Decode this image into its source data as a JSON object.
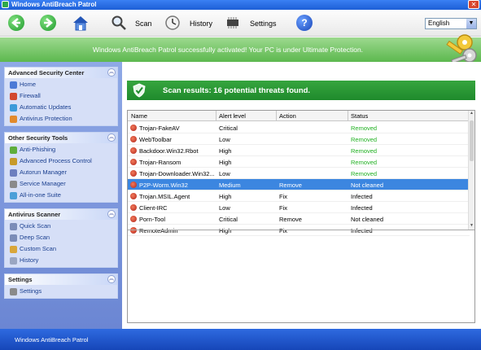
{
  "window": {
    "title": "Windows AntiBreach Patrol",
    "close_label": "✕"
  },
  "toolbar": {
    "back_icon": "arrow-left-icon",
    "forward_icon": "arrow-right-icon",
    "home_icon": "home-icon",
    "scan_label": "Scan",
    "history_label": "History",
    "settings_label": "Settings",
    "help_glyph": "?",
    "language_value": "English"
  },
  "banner": {
    "text": "Windows AntiBreach Patrol successfully activated! Your PC is under Ultimate Protection."
  },
  "sidebar": {
    "groups": [
      {
        "title": "Advanced Security Center",
        "items": [
          "Home",
          "Firewall",
          "Automatic Updates",
          "Antivirus Protection"
        ]
      },
      {
        "title": "Other Security Tools",
        "items": [
          "Anti-Phishing",
          "Advanced Process Control",
          "Autorun Manager",
          "Service Manager",
          "All-in-one Suite"
        ]
      },
      {
        "title": "Antivirus Scanner",
        "items": [
          "Quick Scan",
          "Deep Scan",
          "Custom Scan",
          "History"
        ]
      },
      {
        "title": "Settings",
        "items": [
          "Settings"
        ]
      }
    ]
  },
  "scan": {
    "title": "Scan results: 16 potential threats found."
  },
  "table": {
    "columns": [
      "Name",
      "Alert level",
      "Action",
      "Status"
    ],
    "rows": [
      {
        "name": "Trojan-FakeAV",
        "level": "Critical",
        "action": "",
        "status": "Removed"
      },
      {
        "name": "WebToolbar",
        "level": "Low",
        "action": "",
        "status": "Removed"
      },
      {
        "name": "Backdoor.Win32.Rbot",
        "level": "High",
        "action": "",
        "status": "Removed"
      },
      {
        "name": "Trojan-Ransom",
        "level": "High",
        "action": "",
        "status": "Removed"
      },
      {
        "name": "Trojan-Downloader.Win32...",
        "level": "Low",
        "action": "",
        "status": "Removed"
      },
      {
        "name": "P2P-Worm.Win32",
        "level": "Medium",
        "action": "Remove",
        "status": "Not cleaned"
      },
      {
        "name": "Trojan.MSIL.Agent",
        "level": "High",
        "action": "Fix",
        "status": "Infected"
      },
      {
        "name": "Client-IRC",
        "level": "Low",
        "action": "Fix",
        "status": "Infected"
      },
      {
        "name": "Porn-Tool",
        "level": "Critical",
        "action": "Remove",
        "status": "Not cleaned"
      },
      {
        "name": "RemoteAdmin",
        "level": "High",
        "action": "Fix",
        "status": "Infected"
      }
    ],
    "selected_index": 5
  },
  "footer": {
    "text": "Windows AntiBreach Patrol"
  },
  "colors": {
    "accent_green": "#2a9a34",
    "removed_green": "#21b122",
    "selection_blue": "#3c86e0",
    "sidebar_blue": "#7b96dc"
  }
}
